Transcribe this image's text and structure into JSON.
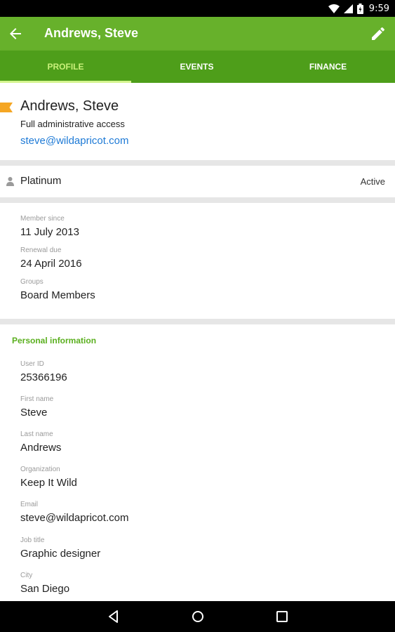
{
  "status_bar": {
    "time": "9:59"
  },
  "app_bar": {
    "title": "Andrews, Steve"
  },
  "tabs": [
    {
      "label": "PROFILE",
      "active": true
    },
    {
      "label": "EVENTS",
      "active": false
    },
    {
      "label": "FINANCE",
      "active": false
    }
  ],
  "contact": {
    "name": "Andrews, Steve",
    "access": "Full administrative access",
    "email": "steve@wildapricot.com"
  },
  "membership": {
    "level": "Platinum",
    "status": "Active"
  },
  "membership_details": [
    {
      "label": "Member since",
      "value": "11 July 2013"
    },
    {
      "label": "Renewal due",
      "value": "24 April 2016"
    },
    {
      "label": "Groups",
      "value": "Board Members"
    }
  ],
  "personal": {
    "header": "Personal information",
    "fields": [
      {
        "label": "User ID",
        "value": "25366196"
      },
      {
        "label": "First name",
        "value": "Steve"
      },
      {
        "label": "Last name",
        "value": "Andrews"
      },
      {
        "label": "Organization",
        "value": "Keep It Wild"
      },
      {
        "label": "Email",
        "value": "steve@wildapricot.com"
      },
      {
        "label": "Job title",
        "value": "Graphic designer"
      },
      {
        "label": "City",
        "value": "San Diego"
      }
    ]
  },
  "colors": {
    "app_bar": "#67b12b",
    "tab_bar": "#4e9e1a",
    "accent": "#5aaf1e",
    "link": "#1e7ad6",
    "flag": "#f5a623"
  },
  "icons": [
    "wifi-icon",
    "signal-icon",
    "battery-icon",
    "back-arrow-icon",
    "edit-pencil-icon",
    "flag-icon",
    "person-icon",
    "nav-back-icon",
    "nav-home-icon",
    "nav-recents-icon"
  ]
}
